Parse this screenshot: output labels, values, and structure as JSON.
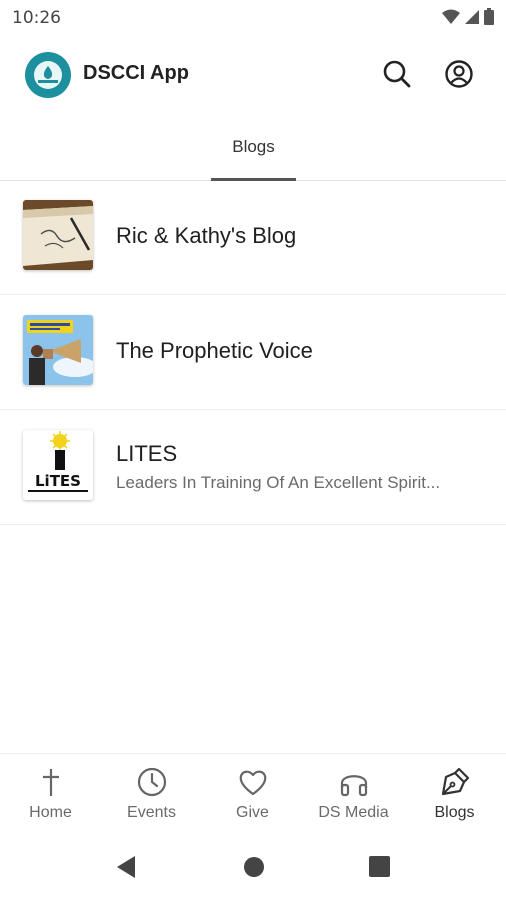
{
  "status_bar": {
    "time": "10:26"
  },
  "app_bar": {
    "title": "DSCCI App",
    "search_icon": "search-icon",
    "account_icon": "account-icon"
  },
  "tabs": [
    {
      "label": "Blogs",
      "active": true
    }
  ],
  "blogs": [
    {
      "title": "Ric & Kathy's Blog",
      "subtitle": "",
      "thumb_icon": "notebook-thumbnail"
    },
    {
      "title": "The Prophetic Voice",
      "subtitle": "",
      "thumb_icon": "megaphone-thumbnail"
    },
    {
      "title": "LITES",
      "subtitle": "Leaders In Training Of An Excellent Spirit...",
      "thumb_icon": "lites-logo-thumbnail",
      "thumb_logo_text": "LiTES"
    }
  ],
  "bottom_nav": [
    {
      "label": "Home",
      "icon": "cross-icon",
      "active": false
    },
    {
      "label": "Events",
      "icon": "clock-icon",
      "active": false
    },
    {
      "label": "Give",
      "icon": "heart-icon",
      "active": false
    },
    {
      "label": "DS Media",
      "icon": "headphones-icon",
      "active": false
    },
    {
      "label": "Blogs",
      "icon": "pen-nib-icon",
      "active": true
    }
  ],
  "colors": {
    "accent": "#1e8f9e",
    "text": "#202020",
    "muted": "#6a6a6a"
  }
}
